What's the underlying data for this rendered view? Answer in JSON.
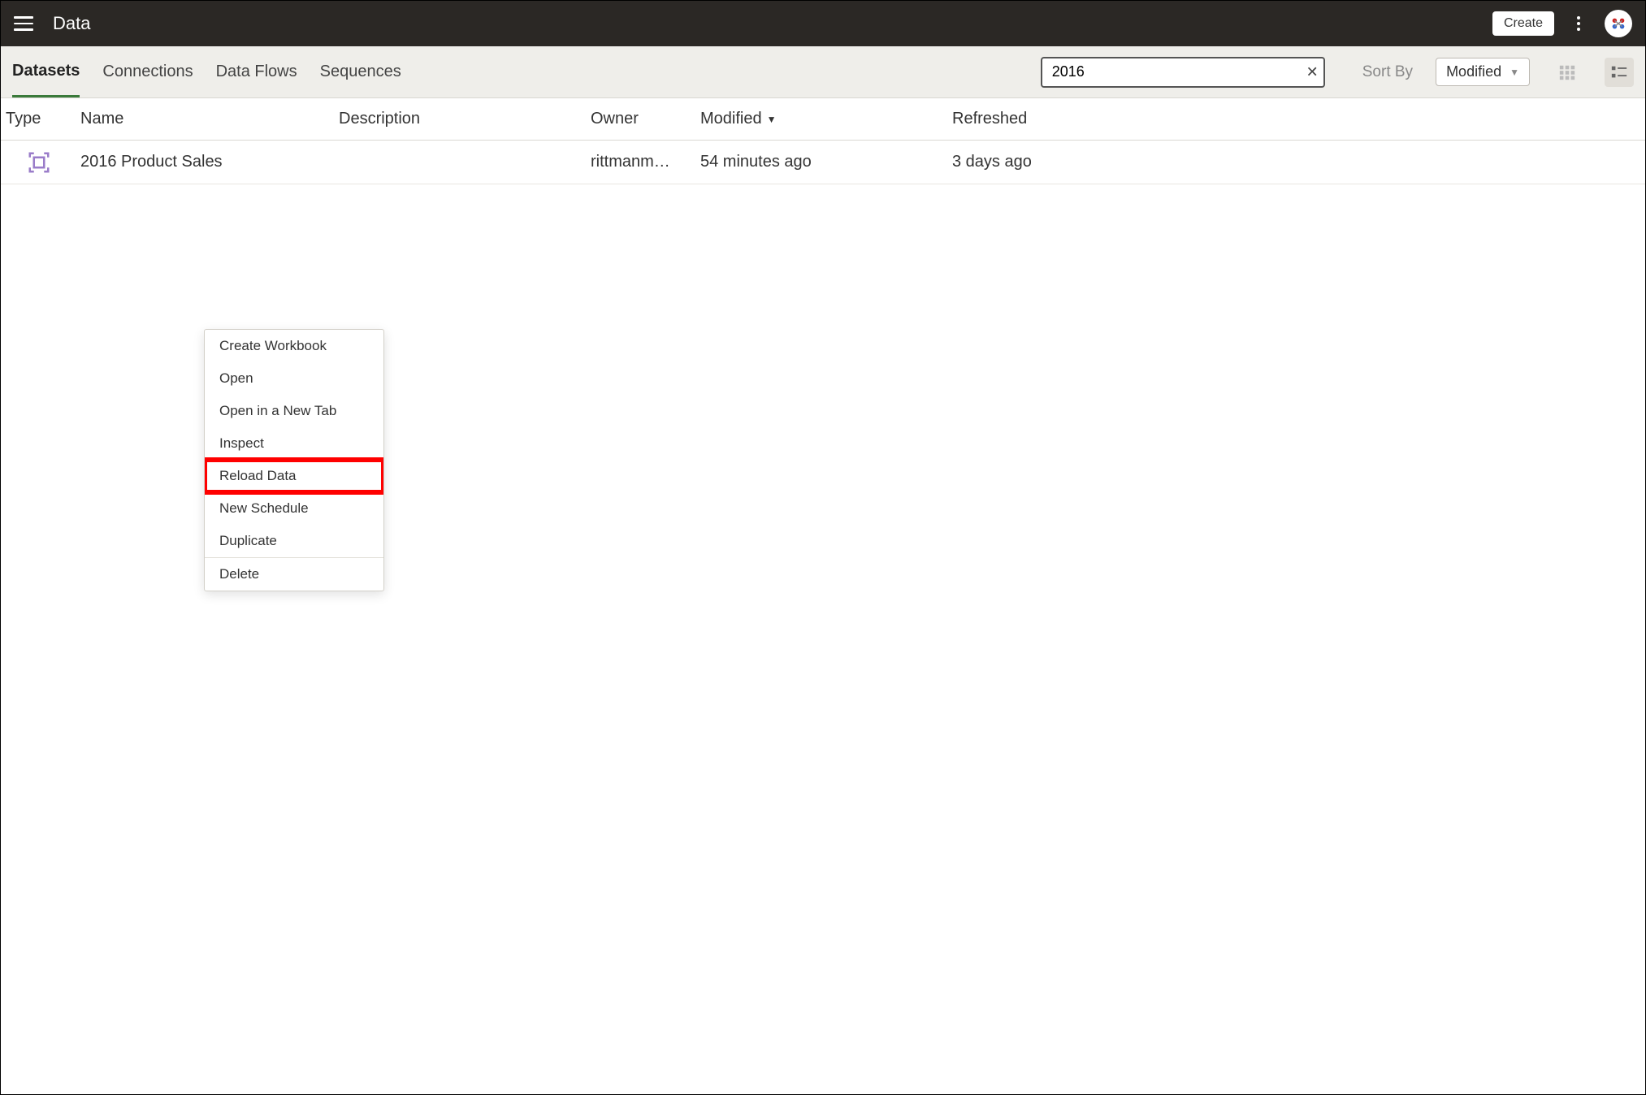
{
  "header": {
    "title": "Data",
    "create_label": "Create"
  },
  "tabs": {
    "items": [
      "Datasets",
      "Connections",
      "Data Flows",
      "Sequences"
    ],
    "active_index": 0
  },
  "search": {
    "value": "2016"
  },
  "sort": {
    "label": "Sort By",
    "selected": "Modified"
  },
  "columns": {
    "type": "Type",
    "name": "Name",
    "description": "Description",
    "owner": "Owner",
    "modified": "Modified",
    "refreshed": "Refreshed"
  },
  "rows": [
    {
      "name": "2016 Product Sales",
      "description": "",
      "owner": "rittmanm…",
      "modified": "54 minutes ago",
      "refreshed": "3 days ago"
    }
  ],
  "context_menu": {
    "items": [
      "Create Workbook",
      "Open",
      "Open in a New Tab",
      "Inspect",
      "Reload Data",
      "New Schedule",
      "Duplicate",
      "Delete"
    ],
    "highlighted_index": 4,
    "divider_after_index": 6
  }
}
